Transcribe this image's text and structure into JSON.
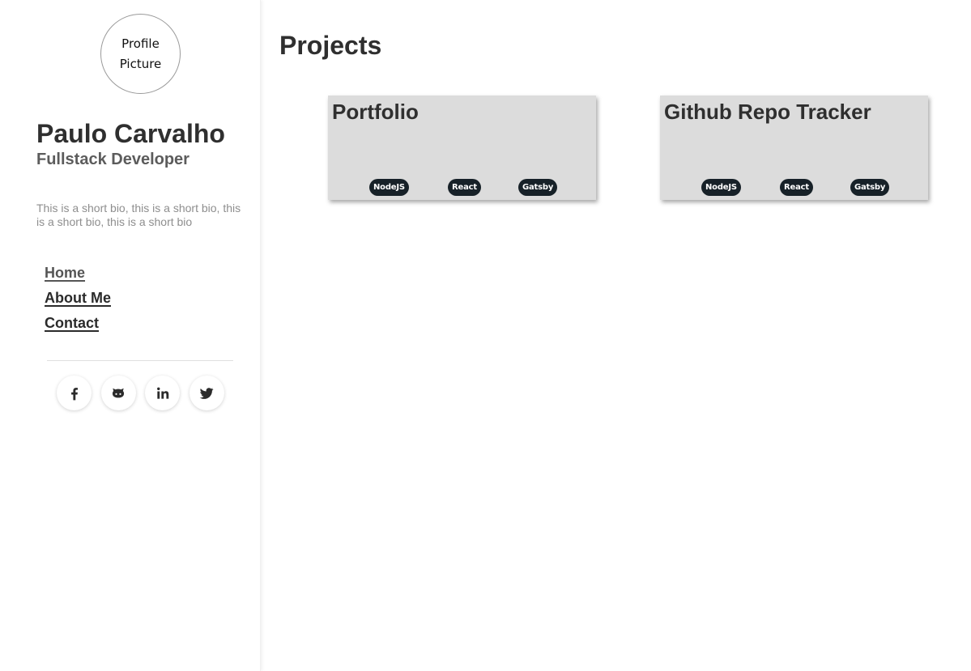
{
  "sidebar": {
    "avatar_text": "Profile Picture",
    "name": "Paulo Carvalho",
    "role": "Fullstack Developer",
    "bio": "This is a short bio, this is a short bio, this is a short bio, this is a short bio",
    "nav": [
      {
        "label": "Home",
        "active": true
      },
      {
        "label": "About Me",
        "active": false
      },
      {
        "label": "Contact",
        "active": false
      }
    ],
    "social_icons": [
      "facebook-icon",
      "github-icon",
      "linkedin-icon",
      "twitter-icon"
    ]
  },
  "main": {
    "title": "Projects",
    "projects": [
      {
        "title": "Portfolio",
        "tags": [
          "NodeJS",
          "React",
          "Gatsby"
        ]
      },
      {
        "title": "Github Repo Tracker",
        "tags": [
          "NodeJS",
          "React",
          "Gatsby"
        ]
      }
    ]
  },
  "colors": {
    "card_bg": "#dcdcdc",
    "tag_bg": "#172128",
    "text": "#2b2b2b"
  }
}
